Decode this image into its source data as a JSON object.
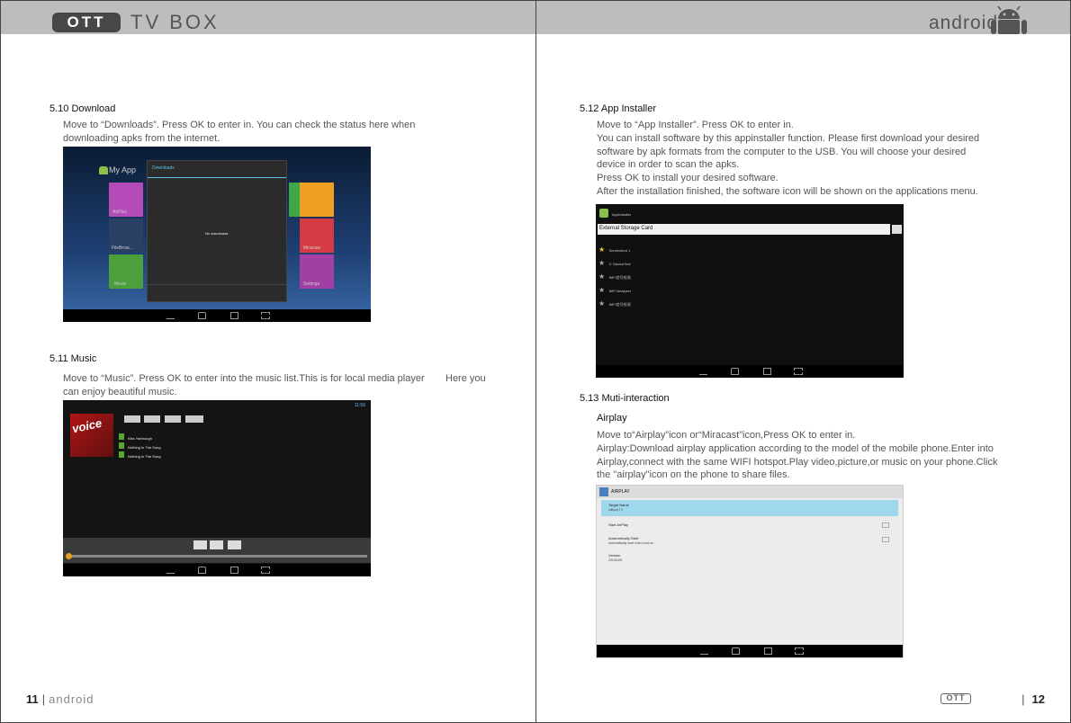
{
  "header": {
    "brand_logo": "OTT",
    "brand_text": "TV BOX",
    "right_word": "android"
  },
  "left": {
    "s510": {
      "title": "5.10 Download",
      "lines": [
        "Move to “Downloads”. Press OK to enter in. You can check the status here when",
        "downloading apks from the internet."
      ],
      "shot": {
        "home_label": "My App",
        "dialog_title": "Downloads",
        "dialog_message": "No downloads",
        "tiles": [
          "AirPlay",
          "FileBrow...",
          "Movie",
          "Miracast",
          "Settings"
        ]
      }
    },
    "s511": {
      "title": "5.11 Music",
      "lines": [
        "Move to “Music”. Press OK to enter into the music list.This is for local media player",
        "can enjoy beautiful music."
      ],
      "overlap": "Here you",
      "shot": {
        "time": "11:56",
        "album": "voice",
        "tracks": [
          "Kiss Yarbrough",
          "Nothing In The Song",
          "Nothing In The Song"
        ]
      }
    },
    "footer": {
      "page_num": "11",
      "sep": "|",
      "word": "android"
    }
  },
  "right": {
    "s512": {
      "title": "5.12 App Installer",
      "lines": [
        "Move to “App Installer”. Press OK to enter in.",
        "You can install software by this appinstaller function. Please first download your desired",
        "software by apk formats from the computer to the USB. You will choose your desired",
        "device in order to scan the apks.",
        "Press OK to install your desired software.",
        "After the installation finished, the software icon will be shown on the applications menu."
      ],
      "shot": {
        "app_title": "AppInstaller",
        "storage": "External Storage Card",
        "items": [
          "Screenshot 1",
          "2. DeviceTest",
          "WiFi信号检测",
          "WiFi Analyzer",
          "WiFi信号检测"
        ]
      }
    },
    "s513": {
      "title": "5.13 Muti-interaction",
      "subtitle": "Airplay",
      "lines": [
        "Move to“Airplay”icon or“Miracast”icon,Press OK to enter in.",
        "Airplay:Download airplay application according to the model of the mobile phone.Enter into",
        "Airplay,connect with the same WIFI hotspot.Play video,picture,or music on your phone.Click",
        "the \"airplay\"icon on the phone to share files."
      ],
      "shot": {
        "bar_title": "AIRPLAY",
        "rows": [
          {
            "label": "Target Name",
            "sub": "lollipop TV"
          },
          {
            "label": "Start AirPlay",
            "sub": ""
          },
          {
            "label": "Automatically Start",
            "sub": "automatically start when boot os"
          },
          {
            "label": "Version",
            "sub": "20131105"
          }
        ]
      }
    },
    "footer": {
      "logo": "OTT",
      "sep": "|",
      "page_num": "12"
    }
  },
  "colors": {
    "header_bg": "#bdbdbd",
    "highlight_blue": "#9fd8ec",
    "accent_green": "#5aa832",
    "text_grey": "#555555"
  }
}
